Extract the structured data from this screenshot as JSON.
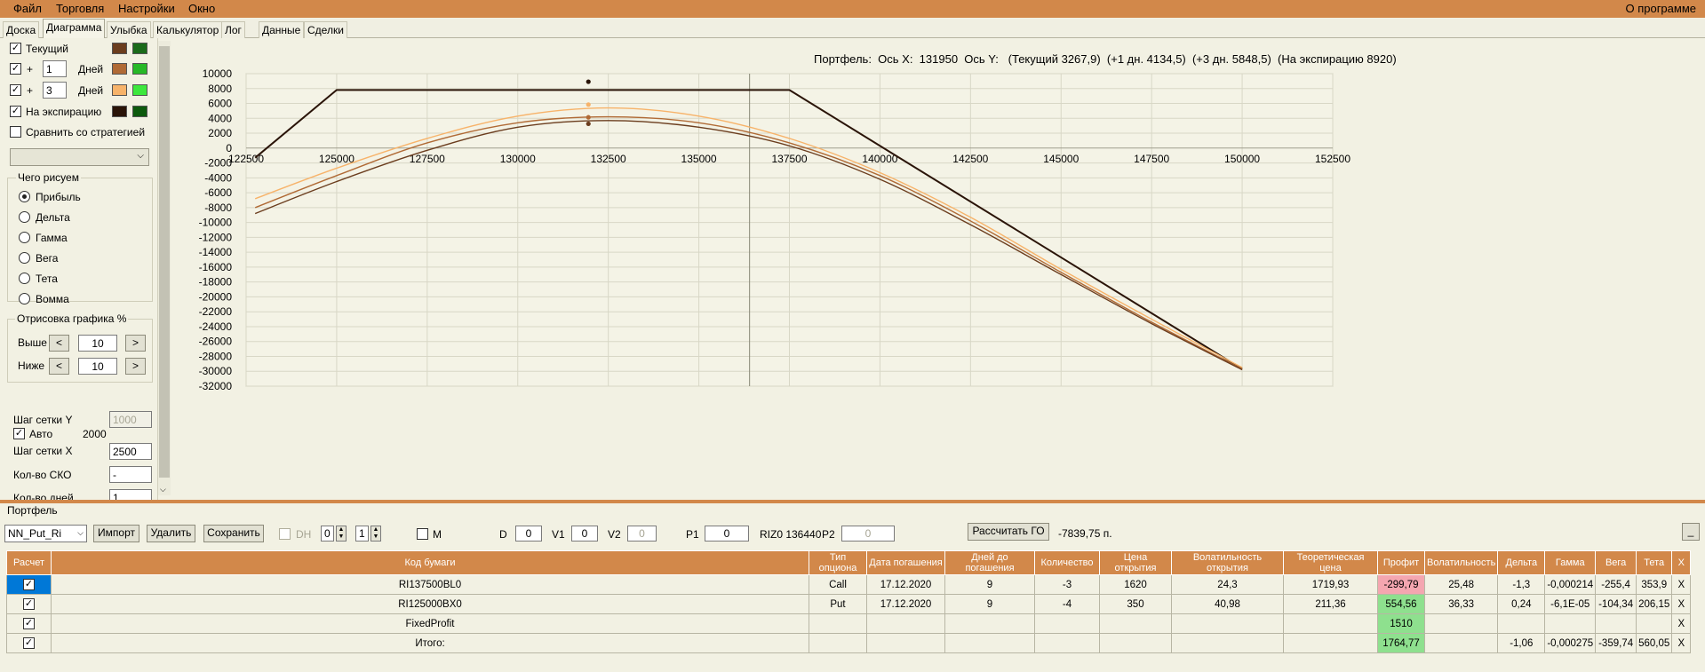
{
  "menu": {
    "items": [
      "Файл",
      "Торговля",
      "Настройки",
      "Окно"
    ],
    "about": "О программе"
  },
  "tabs": [
    "Доска",
    "Диаграмма",
    "Улыбка",
    "Калькулятор",
    "Лог",
    "Данные",
    "Сделки"
  ],
  "active_tab": "Диаграмма",
  "left": {
    "current_label": "Текущий",
    "plus_label": "+",
    "days_label": "Дней",
    "plus_days_1": "1",
    "plus_days_2": "3",
    "expiration_label": "На экспирацию",
    "compare_label": "Сравнить со стратегией",
    "draw_group_title": "Чего рисуем",
    "draw_options": [
      "Прибыль",
      "Дельта",
      "Гамма",
      "Вега",
      "Тета",
      "Вомма"
    ],
    "draw_selected": "Прибыль",
    "render_group_title": "Отрисовка графика %",
    "above_label": "Выше",
    "below_label": "Ниже",
    "above_value": "10",
    "below_value": "10",
    "prev_btn": "<",
    "next_btn": ">",
    "grid_y_label": "Шаг сетки Y",
    "grid_y_value": "1000",
    "auto_label": "Авто",
    "auto_value": "2000",
    "grid_x_label": "Шаг сетки X",
    "grid_x_value": "2500",
    "sko_label": "Кол-во СКО",
    "sko_value": "-",
    "days_count_label": "Кол-во дней",
    "days_count_value": "1",
    "colors": {
      "current": [
        "#6b3d1e",
        "#1a6a1a"
      ],
      "plus1": [
        "#b06a35",
        "#27b827"
      ],
      "plus3": [
        "#f7b36a",
        "#3de83d"
      ],
      "expiration": [
        "#2a1408",
        "#0d5a0d"
      ]
    }
  },
  "chart": {
    "title": "Портфель:  Ось X:  131950  Ось Y:   (Текущий 3267,9)  (+1 дн. 4134,5)  (+3 дн. 5848,5)  (На экспирацию 8920)"
  },
  "chart_data": {
    "type": "line",
    "title": "Портфель:  Ось X:  131950  Ось Y:   (Текущий 3267,9)  (+1 дн. 4134,5)  (+3 дн. 5848,5)  (На экспирацию 8920)",
    "xlim": [
      122500,
      152500
    ],
    "ylim": [
      -32000,
      10000
    ],
    "x_ticks": [
      122500,
      125000,
      127500,
      130000,
      132500,
      135000,
      137500,
      140000,
      142500,
      145000,
      147500,
      150000,
      152500
    ],
    "y_ticks": [
      10000,
      8000,
      6000,
      4000,
      2000,
      0,
      -2000,
      -4000,
      -6000,
      -8000,
      -10000,
      -12000,
      -14000,
      -16000,
      -18000,
      -20000,
      -22000,
      -24000,
      -26000,
      -28000,
      -30000,
      -32000
    ],
    "cursor_x": 136400,
    "markers": [
      {
        "x": 131950,
        "y": 8920,
        "color": "#2a1408"
      },
      {
        "x": 131950,
        "y": 5848.5,
        "color": "#f7b36a"
      },
      {
        "x": 131950,
        "y": 4134.5,
        "color": "#b06a35"
      },
      {
        "x": 131950,
        "y": 3267.9,
        "color": "#6b3d1e"
      }
    ],
    "series": [
      {
        "color": "#2a1408",
        "x": [
          122750,
          125000,
          137500,
          150000
        ],
        "y": [
          -1300,
          7800,
          7800,
          -29700
        ]
      },
      {
        "color": "#f7b36a",
        "x": [
          122750,
          125000,
          127500,
          130000,
          132500,
          135000,
          137500,
          140000,
          142500,
          145000,
          147500,
          150000
        ],
        "y": [
          -6800,
          -2700,
          1300,
          4300,
          5400,
          4300,
          1300,
          -3300,
          -9300,
          -16300,
          -23000,
          -29500
        ]
      },
      {
        "color": "#b06a35",
        "x": [
          122750,
          125000,
          127500,
          130000,
          132500,
          135000,
          137500,
          140000,
          142500,
          145000,
          147500,
          150000
        ],
        "y": [
          -8000,
          -3700,
          700,
          3400,
          4200,
          3400,
          700,
          -3700,
          -9800,
          -16700,
          -23400,
          -29700
        ]
      },
      {
        "color": "#6b3d1e",
        "x": [
          122750,
          125000,
          127500,
          130000,
          132500,
          135000,
          137500,
          140000,
          142500,
          145000,
          147500,
          150000
        ],
        "y": [
          -8800,
          -4500,
          -300,
          2800,
          3700,
          2800,
          300,
          -4200,
          -10300,
          -17000,
          -23600,
          -29800
        ]
      }
    ]
  },
  "portfolio": {
    "title": "Портфель",
    "name": "NN_Put_Ri",
    "import_btn": "Импорт",
    "delete_btn": "Удалить",
    "save_btn": "Сохранить",
    "dh_label": "DH",
    "spin1": "0",
    "spin2": "1",
    "m_label": "M",
    "d_label": "D",
    "d_value": "0",
    "v1_label": "V1",
    "v1_value": "0",
    "v2_label": "V2",
    "v2_value": "0",
    "p1_label": "P1",
    "p1_value": "0",
    "riz_label": "RIZ0 136440",
    "p2_label": "P2",
    "p2_value": "0",
    "calc_go_btn": "Рассчитать ГО",
    "go_value": "-7839,75 п.",
    "min_btn": "_"
  },
  "table": {
    "headers": [
      "Расчет",
      "Код бумаги",
      "Тип опциона",
      "Дата погашения",
      "Дней до погашения",
      "Количество",
      "Цена открытия",
      "Волатильность открытия",
      "Теоретическая цена",
      "Профит",
      "Волатильность",
      "Дельта",
      "Гамма",
      "Вега",
      "Тета",
      "X"
    ],
    "rows": [
      [
        "RI137500BL0",
        "Call",
        "17.12.2020",
        "9",
        "-3",
        "1620",
        "24,3",
        "1719,93",
        "-299,79",
        "25,48",
        "-1,3",
        "-0,000214",
        "-255,4",
        "353,9",
        "X"
      ],
      [
        "RI125000BX0",
        "Put",
        "17.12.2020",
        "9",
        "-4",
        "350",
        "40,98",
        "211,36",
        "554,56",
        "36,33",
        "0,24",
        "-6,1E-05",
        "-104,34",
        "206,15",
        "X"
      ],
      [
        "FixedProfit",
        "",
        "",
        "",
        "",
        "",
        "",
        "",
        "1510",
        "",
        "",
        "",
        "",
        "",
        "X"
      ],
      [
        "Итого:",
        "",
        "",
        "",
        "",
        "",
        "",
        "",
        "1764,77",
        "",
        "-1,06",
        "-0,000275",
        "-359,74",
        "560,05",
        "X"
      ]
    ]
  }
}
